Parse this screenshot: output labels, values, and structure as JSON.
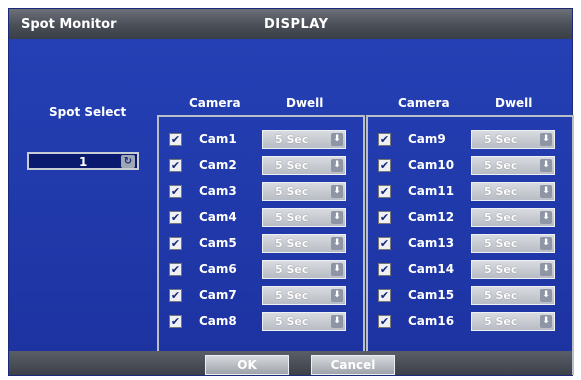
{
  "window": {
    "title_left": "Spot Monitor",
    "title_center": "DISPLAY"
  },
  "spot": {
    "label": "Spot Select",
    "value": "1",
    "icon": "refresh-icon"
  },
  "headers": {
    "camera": "Camera",
    "dwell": "Dwell"
  },
  "cameras_left": [
    {
      "name": "Cam1",
      "checked": true,
      "dwell": "5 Sec"
    },
    {
      "name": "Cam2",
      "checked": true,
      "dwell": "5 Sec"
    },
    {
      "name": "Cam3",
      "checked": true,
      "dwell": "5 Sec"
    },
    {
      "name": "Cam4",
      "checked": true,
      "dwell": "5 Sec"
    },
    {
      "name": "Cam5",
      "checked": true,
      "dwell": "5 Sec"
    },
    {
      "name": "Cam6",
      "checked": true,
      "dwell": "5 Sec"
    },
    {
      "name": "Cam7",
      "checked": true,
      "dwell": "5 Sec"
    },
    {
      "name": "Cam8",
      "checked": true,
      "dwell": "5 Sec"
    }
  ],
  "cameras_right": [
    {
      "name": "Cam9",
      "checked": true,
      "dwell": "5 Sec"
    },
    {
      "name": "Cam10",
      "checked": true,
      "dwell": "5 Sec"
    },
    {
      "name": "Cam11",
      "checked": true,
      "dwell": "5 Sec"
    },
    {
      "name": "Cam12",
      "checked": true,
      "dwell": "5 Sec"
    },
    {
      "name": "Cam13",
      "checked": true,
      "dwell": "5 Sec"
    },
    {
      "name": "Cam14",
      "checked": true,
      "dwell": "5 Sec"
    },
    {
      "name": "Cam15",
      "checked": true,
      "dwell": "5 Sec"
    },
    {
      "name": "Cam16",
      "checked": true,
      "dwell": "5 Sec"
    }
  ],
  "buttons": {
    "ok": "OK",
    "cancel": "Cancel"
  },
  "colors": {
    "panel": "#2440b4",
    "titlebar": "#55595f"
  }
}
